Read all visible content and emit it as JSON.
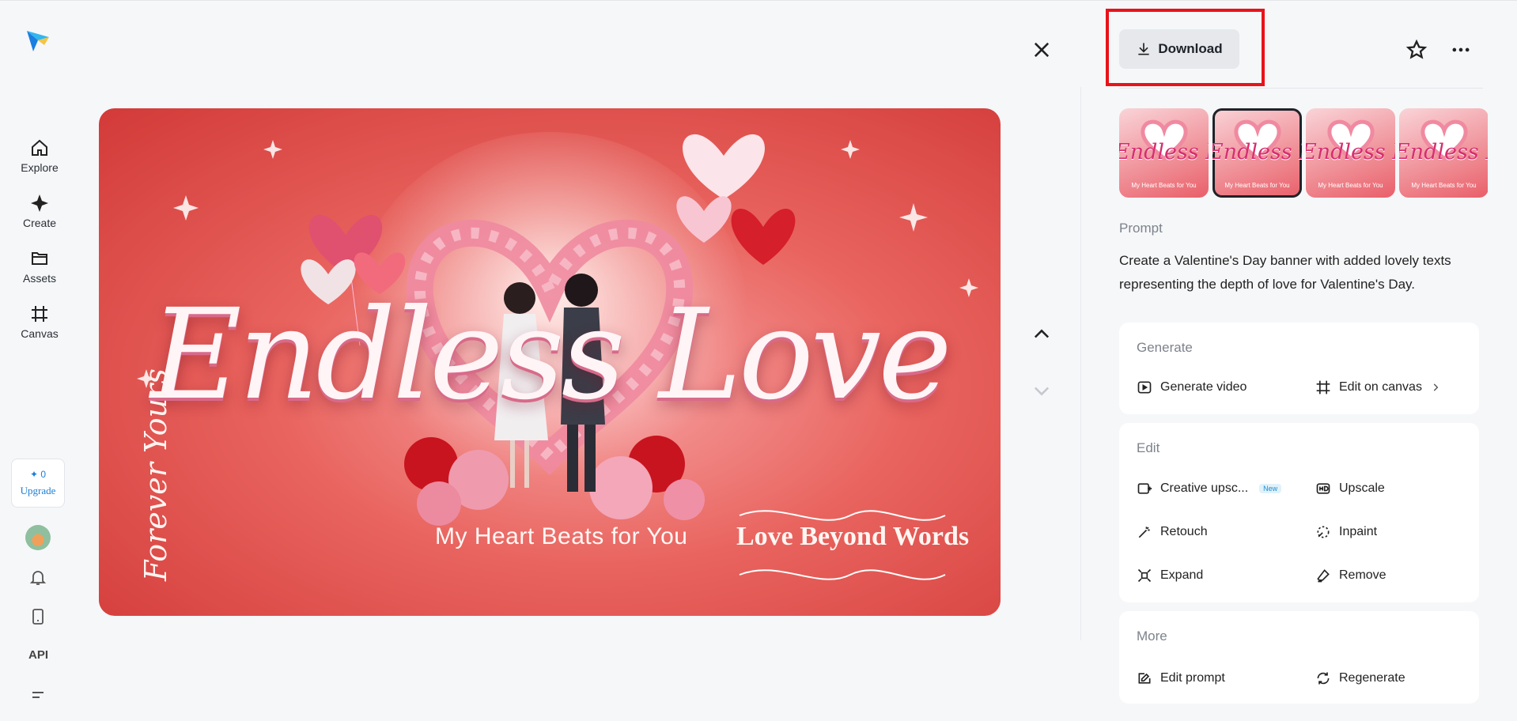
{
  "nav": {
    "items": [
      {
        "label": "Explore",
        "icon": "home-icon"
      },
      {
        "label": "Create",
        "icon": "sparkle-icon"
      },
      {
        "label": "Assets",
        "icon": "folder-icon"
      },
      {
        "label": "Canvas",
        "icon": "canvas-icon"
      }
    ],
    "credits": "0",
    "upgrade_label": "Upgrade",
    "api_label": "API"
  },
  "banner": {
    "title": "Endless Love",
    "subtitle": "My Heart Beats for You",
    "side_text": "Forever Yours",
    "tag_text": "Love Beyond Words"
  },
  "toolbar": {
    "download_label": "Download"
  },
  "thumbnails": [
    {
      "title": "Endless Love",
      "sub": "My Heart Beats for You",
      "selected": false
    },
    {
      "title": "Endless Love",
      "sub": "My Heart Beats for You",
      "selected": true
    },
    {
      "title": "Endless Love",
      "sub": "My Heart Beats for You",
      "selected": false
    },
    {
      "title": "Endless Love",
      "sub": "My Heart Beats for You",
      "selected": false
    }
  ],
  "prompt": {
    "label": "Prompt",
    "text": "Create a Valentine's Day banner with added lovely texts representing the depth of love for Valentine's Day."
  },
  "generate": {
    "title": "Generate",
    "video_label": "Generate video",
    "canvas_label": "Edit on canvas"
  },
  "edit": {
    "title": "Edit",
    "creative_upscale_label": "Creative upsc...",
    "new_badge": "New",
    "upscale_label": "Upscale",
    "retouch_label": "Retouch",
    "inpaint_label": "Inpaint",
    "expand_label": "Expand",
    "remove_label": "Remove"
  },
  "more": {
    "title": "More",
    "edit_prompt_label": "Edit prompt",
    "regenerate_label": "Regenerate"
  },
  "colors": {
    "accent_red": "#e8131a",
    "link_blue": "#1b7fd6",
    "banner_red": "#d23a38"
  }
}
